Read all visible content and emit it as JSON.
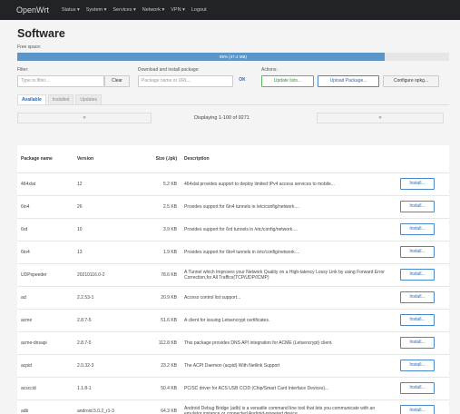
{
  "header": {
    "brand": "OpenWrt",
    "menu": [
      "Status ▾",
      "System ▾",
      "Services ▾",
      "Network ▾",
      "VPN ▾",
      "Logout"
    ]
  },
  "page": {
    "title": "Software",
    "free_space_label": "Free space:",
    "free_space_text": "85% (47.4 MB)",
    "free_space_fraction": 0.85
  },
  "filter": {
    "label": "Filter:",
    "placeholder": "Type to filter...",
    "clear_label": "Clear"
  },
  "download": {
    "label": "Download and install package:",
    "placeholder": "Package name or URL...",
    "ok_label": "OK"
  },
  "actions": {
    "label": "Actions:",
    "update_lists": "Update lists...",
    "upload_package": "Upload Package...",
    "configure_opkg": "Configure opkg..."
  },
  "tabs": [
    "Available",
    "Installed",
    "Updates"
  ],
  "pager": {
    "prev": "«",
    "next": "»",
    "status": "Displaying 1-100 of 9271"
  },
  "table": {
    "columns": [
      "Package name",
      "Version",
      "Size (.ipk)",
      "Description"
    ],
    "install_label": "Install...",
    "rows": [
      {
        "name": "464xlat",
        "version": "12",
        "size": "5.2 KB",
        "desc": "464xlat provides support to deploy limited IPv4 access services to mobile..."
      },
      {
        "name": "6in4",
        "version": "26",
        "size": "2.5 KB",
        "desc": "Provides support for 6in4 tunnels in /etc/config/network...."
      },
      {
        "name": "6rd",
        "version": "10",
        "size": "3.9 KB",
        "desc": "Provides support for 6rd tunnels in /etc/config/network...."
      },
      {
        "name": "6to4",
        "version": "13",
        "size": "1.9 KB",
        "desc": "Provides support for 6to4 tunnels in /etc/config/network...."
      },
      {
        "name": "UDPspeeder",
        "version": "20210116.0-2",
        "size": "78.6 KB",
        "desc": "A Tunnel which Improves your Network Quality on a High-latency Lossy Link by using Forward Error Correction,for All Traffics(TCP/UDP/ICMP)"
      },
      {
        "name": "acl",
        "version": "2.2.53-1",
        "size": "20.9 KB",
        "desc": "Access control list support..."
      },
      {
        "name": "acme",
        "version": "2.8.7-5",
        "size": "51.6 KB",
        "desc": "A client for issuing Letsencrypt certificates."
      },
      {
        "name": "acme-dnsapi",
        "version": "2.8.7-5",
        "size": "112.8 KB",
        "desc": "This package provides DNS API integration for ACME (Letsencrypt) client."
      },
      {
        "name": "acpid",
        "version": "2.0.32-3",
        "size": "23.2 KB",
        "desc": "The ACPI Daemon (acpid) With Netlink Support"
      },
      {
        "name": "acsccid",
        "version": "1.1.8-1",
        "size": "50.4 KB",
        "desc": "PC/SC driver for ACS USB CCID (Chip/Smart Card Interface Devices)..."
      },
      {
        "name": "adb",
        "version": "android.5.0.2_r1-3",
        "size": "64.3 KB",
        "desc": "Android Debug Bridge (adb) is a versatile command line tool that lets you communicate with an emulator instance or connected Android-powered device..."
      }
    ]
  }
}
